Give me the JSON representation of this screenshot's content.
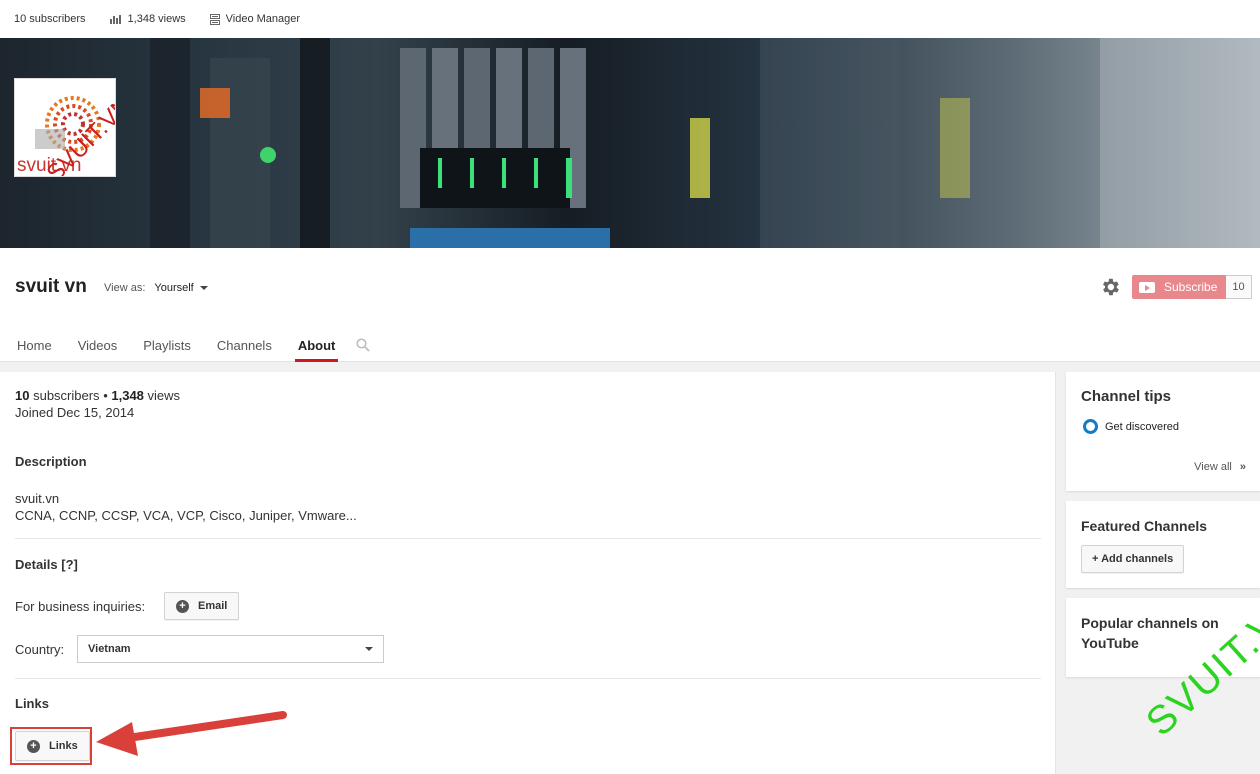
{
  "topbar": {
    "subscribers": "10 subscribers",
    "views": "1,348 views",
    "video_manager": "Video Manager"
  },
  "logo": {
    "text": "svuit.vn",
    "overlay": "SVUIT.VN"
  },
  "channel": {
    "title": "svuit vn",
    "view_as_label": "View as:",
    "view_as_value": "Yourself",
    "subscribe_label": "Subscribe",
    "subscribe_count": "10"
  },
  "tabs": [
    {
      "label": "Home"
    },
    {
      "label": "Videos"
    },
    {
      "label": "Playlists"
    },
    {
      "label": "Channels"
    },
    {
      "label": "About"
    }
  ],
  "about": {
    "subscribers": "10",
    "subscribers_word": "subscribers",
    "views": "1,348",
    "views_word": "views",
    "joined": "Joined Dec 15, 2014",
    "description_heading": "Description",
    "description_line1": "svuit.vn",
    "description_line2": "CCNA, CCNP, CCSP, VCA, VCP, Cisco, Juniper, Vmware...",
    "details_heading": "Details [?]",
    "business_label": "For business inquiries:",
    "email_button": "Email",
    "country_label": "Country:",
    "country_value": "Vietnam",
    "links_heading": "Links",
    "links_button": "Links"
  },
  "sidebar": {
    "tips_title": "Channel tips",
    "tip_item": "Get discovered",
    "view_all": "View all",
    "view_all_chevron": "»",
    "featured_title": "Featured Channels",
    "add_channels": "+ Add channels",
    "popular_title_line1": "Popular channels on",
    "popular_title_line2": "YouTube"
  },
  "watermark": "SVUIT.VN",
  "colors": {
    "accent_red": "#cc181e",
    "subscribe_bg": "#e9888c",
    "tip_ring": "#167ac6",
    "annotation_red": "#d9403a",
    "watermark_green": "#2bd41e"
  }
}
